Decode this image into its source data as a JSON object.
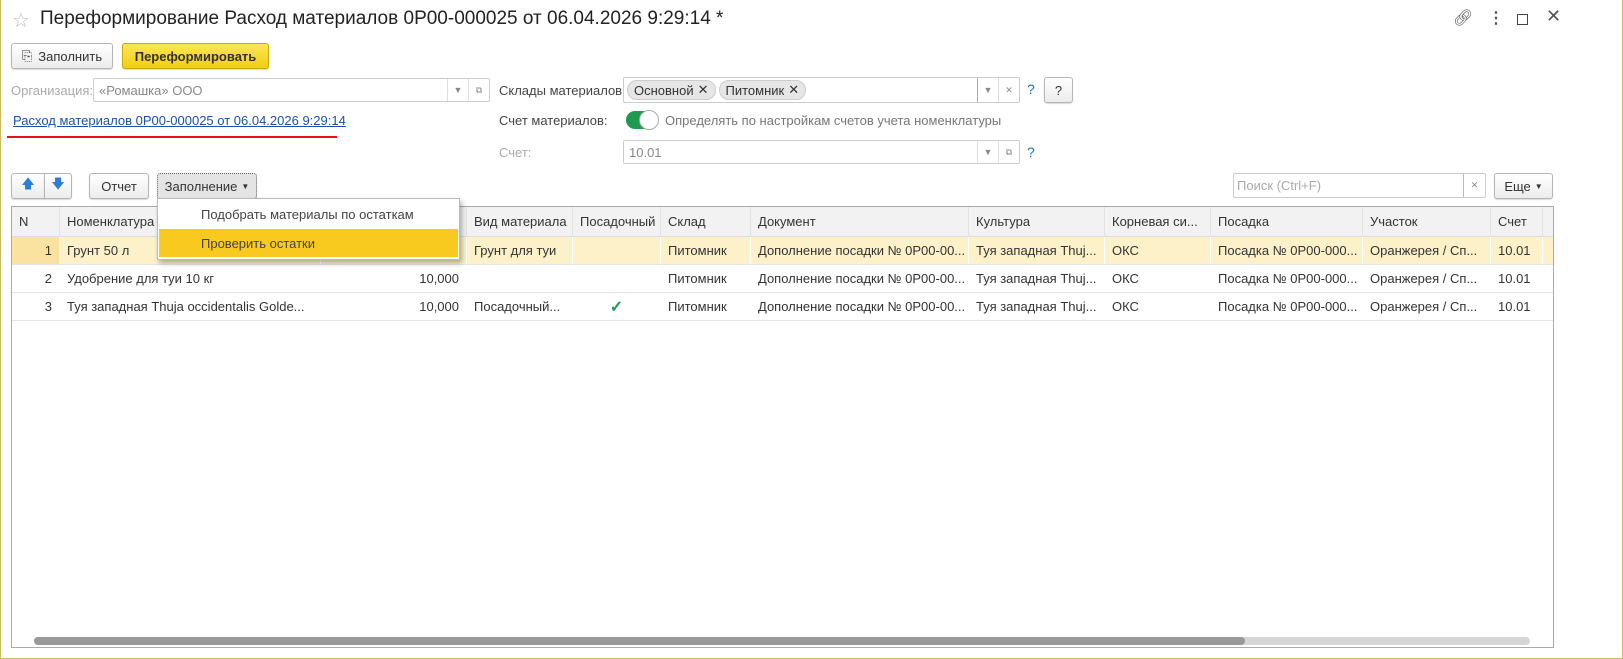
{
  "window": {
    "title": "Переформирование Расход материалов 0Р00-000025 от 06.04.2026 9:29:14 *"
  },
  "toolbar": {
    "fill_label": "Заполнить",
    "reform_label": "Переформировать"
  },
  "form": {
    "org_label": "Организация:",
    "org_value": "«Ромашка» ООО",
    "doc_link": "Расход материалов 0Р00-000025 от 06.04.2026 9:29:14",
    "warehouses_label": "Склады материалов:",
    "warehouses": [
      "Основной",
      "Питомник"
    ],
    "account_label": "Счет материалов:",
    "account_toggle_on": true,
    "account_toggle_text": "Определять по настройкам счетов учета номенклатуры",
    "schet_label": "Счет:",
    "schet_value": "10.01",
    "help": "?"
  },
  "table_toolbar": {
    "report_label": "Отчет",
    "fill_menu_label": "Заполнение",
    "search_placeholder": "Поиск (Ctrl+F)",
    "more_label": "Еще"
  },
  "fill_menu": {
    "items": [
      "Подобрать материалы по остаткам",
      "Проверить остатки"
    ],
    "highlighted": 1
  },
  "table": {
    "columns": [
      "N",
      "Номенклатура",
      "",
      "Вид материала",
      "Посадочный",
      "Склад",
      "Документ",
      "Культура",
      "Корневая си...",
      "Посадка",
      "Участок",
      "Счет"
    ],
    "rows": [
      [
        "1",
        "Грунт 50 л",
        "",
        "Грунт для туи",
        "",
        "Питомник",
        "Дополнение посадки № 0Р00-00...",
        "Туя западная Thuj...",
        "ОКС",
        "Посадка № 0Р00-000...",
        "Оранжерея / Сп...",
        "10.01"
      ],
      [
        "2",
        "Удобрение для туи 10 кг",
        "10,000",
        "",
        "",
        "Питомник",
        "Дополнение посадки № 0Р00-00...",
        "Туя западная Thuj...",
        "ОКС",
        "Посадка № 0Р00-000...",
        "Оранжерея / Сп...",
        "10.01"
      ],
      [
        "3",
        "Туя западная Thuja occidentalis Golde...",
        "10,000",
        "Посадочный...",
        "✓",
        "Питомник",
        "Дополнение посадки № 0Р00-00...",
        "Туя западная Thuj...",
        "ОКС",
        "Посадка № 0Р00-000...",
        "Оранжерея / Сп...",
        "10.01"
      ]
    ],
    "selected_row": 0
  },
  "colors": {
    "accent": "#f8ca1f",
    "link": "#1f4fa8",
    "toggle": "#1f9a4f",
    "check": "#1f9a4f"
  }
}
